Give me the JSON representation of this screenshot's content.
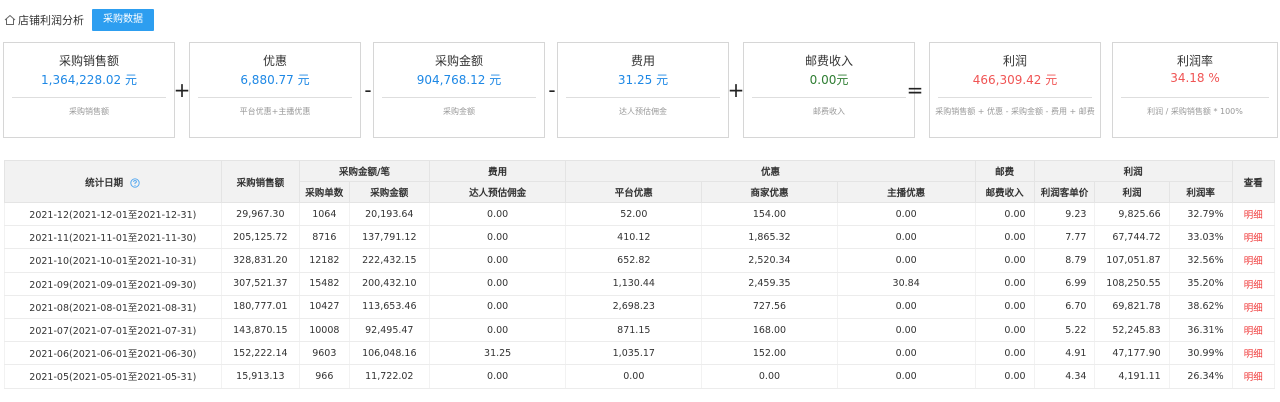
{
  "header": {
    "breadcrumb": "店铺利润分析",
    "tag_button": "采购数据"
  },
  "cards": [
    {
      "title": "采购销售额",
      "value": "1,364,228.02 元",
      "desc": "采购销售额"
    },
    {
      "title": "优惠",
      "value": "6,880.77 元",
      "desc": "平台优惠+主播优惠"
    },
    {
      "title": "采购金额",
      "value": "904,768.12 元",
      "desc": "采购金额"
    },
    {
      "title": "费用",
      "value": "31.25 元",
      "desc": "达人预估佣金"
    },
    {
      "title": "邮费收入",
      "value": "0.00元",
      "desc": "邮费收入"
    },
    {
      "title": "利润",
      "value": "466,309.42 元",
      "desc": "采购销售额 + 优惠 - 采购金额 - 费用 + 邮费"
    },
    {
      "title": "利润率",
      "value": "34.18 %",
      "desc": "利润 / 采购销售额 * 100%"
    }
  ],
  "operators": [
    "+",
    "-",
    "-",
    "+",
    "="
  ],
  "colors": {
    "accent": "#2d9ef0",
    "value_blue": "#1e88e5",
    "value_green": "#2e7d32",
    "value_red": "#f05454",
    "link_red": "#f03c3c"
  },
  "table": {
    "group_headers": {
      "date": "统计日期",
      "sales": "采购销售额",
      "purchase": "采购金额/笔",
      "fee": "费用",
      "discount": "优惠",
      "postage": "邮费",
      "profit": "利润",
      "view": "查看"
    },
    "sub_headers": {
      "purchase_count": "采购单数",
      "purchase_amount": "采购金额",
      "commission": "达人预估佣金",
      "platform_discount": "平台优惠",
      "merchant_discount": "商家优惠",
      "anchor_discount": "主播优惠",
      "postage_income": "邮费收入",
      "profit_per_order": "利润客单价",
      "profit": "利润",
      "profit_rate": "利润率"
    },
    "rows": [
      {
        "date": "2021-12(2021-12-01至2021-12-31)",
        "sales": "29,967.30",
        "count": "1064",
        "amount": "20,193.64",
        "commission": "0.00",
        "platform": "52.00",
        "merchant": "154.00",
        "anchor": "0.00",
        "postage": "0.00",
        "per_order": "9.23",
        "profit": "9,825.66",
        "rate": "32.79%",
        "action": "明细"
      },
      {
        "date": "2021-11(2021-11-01至2021-11-30)",
        "sales": "205,125.72",
        "count": "8716",
        "amount": "137,791.12",
        "commission": "0.00",
        "platform": "410.12",
        "merchant": "1,865.32",
        "anchor": "0.00",
        "postage": "0.00",
        "per_order": "7.77",
        "profit": "67,744.72",
        "rate": "33.03%",
        "action": "明细"
      },
      {
        "date": "2021-10(2021-10-01至2021-10-31)",
        "sales": "328,831.20",
        "count": "12182",
        "amount": "222,432.15",
        "commission": "0.00",
        "platform": "652.82",
        "merchant": "2,520.34",
        "anchor": "0.00",
        "postage": "0.00",
        "per_order": "8.79",
        "profit": "107,051.87",
        "rate": "32.56%",
        "action": "明细"
      },
      {
        "date": "2021-09(2021-09-01至2021-09-30)",
        "sales": "307,521.37",
        "count": "15482",
        "amount": "200,432.10",
        "commission": "0.00",
        "platform": "1,130.44",
        "merchant": "2,459.35",
        "anchor": "30.84",
        "postage": "0.00",
        "per_order": "6.99",
        "profit": "108,250.55",
        "rate": "35.20%",
        "action": "明细"
      },
      {
        "date": "2021-08(2021-08-01至2021-08-31)",
        "sales": "180,777.01",
        "count": "10427",
        "amount": "113,653.46",
        "commission": "0.00",
        "platform": "2,698.23",
        "merchant": "727.56",
        "anchor": "0.00",
        "postage": "0.00",
        "per_order": "6.70",
        "profit": "69,821.78",
        "rate": "38.62%",
        "action": "明细"
      },
      {
        "date": "2021-07(2021-07-01至2021-07-31)",
        "sales": "143,870.15",
        "count": "10008",
        "amount": "92,495.47",
        "commission": "0.00",
        "platform": "871.15",
        "merchant": "168.00",
        "anchor": "0.00",
        "postage": "0.00",
        "per_order": "5.22",
        "profit": "52,245.83",
        "rate": "36.31%",
        "action": "明细"
      },
      {
        "date": "2021-06(2021-06-01至2021-06-30)",
        "sales": "152,222.14",
        "count": "9603",
        "amount": "106,048.16",
        "commission": "31.25",
        "platform": "1,035.17",
        "merchant": "152.00",
        "anchor": "0.00",
        "postage": "0.00",
        "per_order": "4.91",
        "profit": "47,177.90",
        "rate": "30.99%",
        "action": "明细"
      },
      {
        "date": "2021-05(2021-05-01至2021-05-31)",
        "sales": "15,913.13",
        "count": "966",
        "amount": "11,722.02",
        "commission": "0.00",
        "platform": "0.00",
        "merchant": "0.00",
        "anchor": "0.00",
        "postage": "0.00",
        "per_order": "4.34",
        "profit": "4,191.11",
        "rate": "26.34%",
        "action": "明细"
      }
    ]
  }
}
